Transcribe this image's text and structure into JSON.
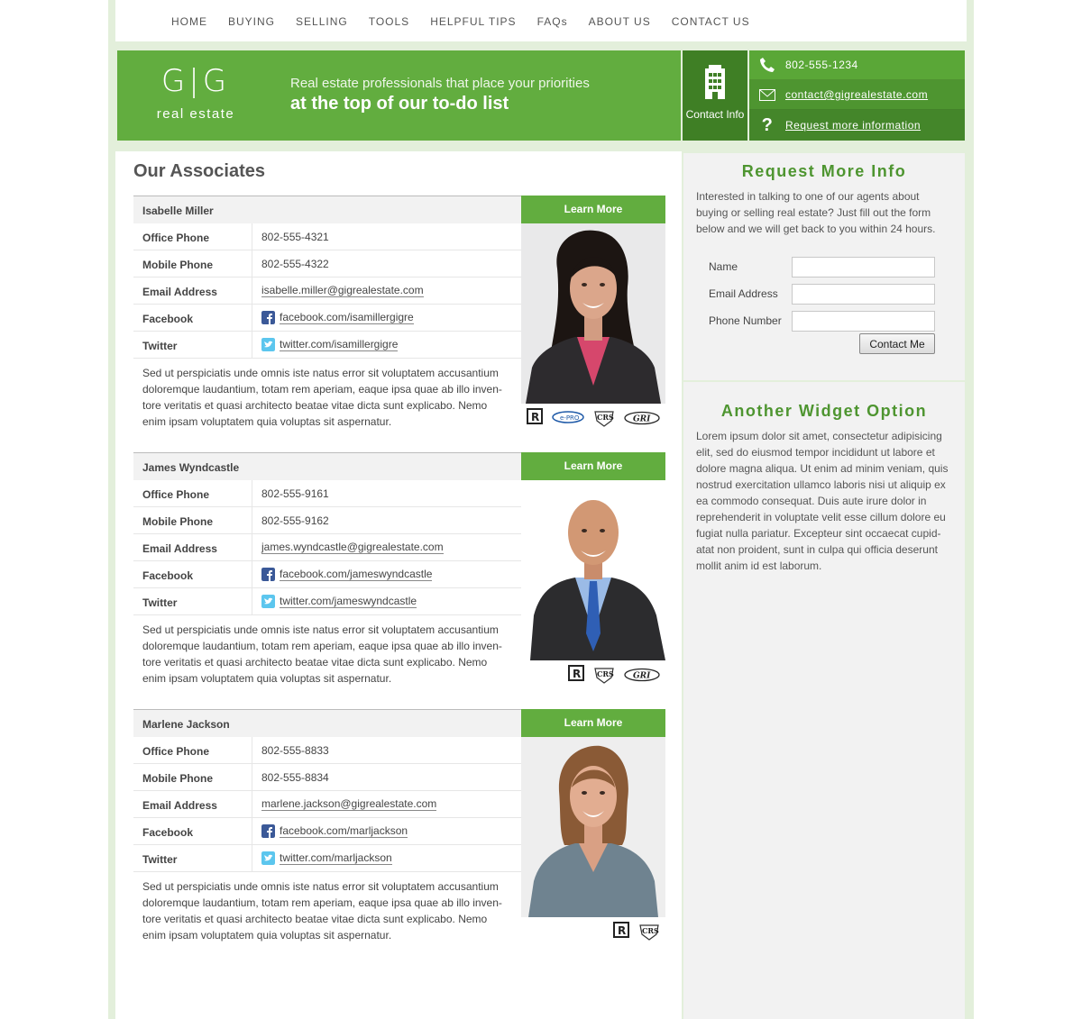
{
  "nav": {
    "items": [
      "HOME",
      "BUYING",
      "SELLING",
      "TOOLS",
      "HELPFUL TIPS",
      "FAQs",
      "ABOUT US",
      "CONTACT US"
    ]
  },
  "header": {
    "logo_mark": "G|G",
    "logo_text": "real estate",
    "tagline_line1": "Real estate professionals that place your priorities",
    "tagline_line2": "at the top of our to-do list",
    "contact_box_label": "Contact Info",
    "phone": "802-555-1234",
    "email": "contact@gigrealestate.com",
    "request": "Request more information"
  },
  "main": {
    "title": "Our Associates",
    "labels": {
      "office": "Office Phone",
      "mobile": "Mobile Phone",
      "email": "Email Address",
      "facebook": "Facebook",
      "twitter": "Twitter",
      "learn_more": "Learn More"
    },
    "associates": [
      {
        "name": "Isabelle Miller",
        "office": "802-555-4321",
        "mobile": "802-555-4322",
        "email": "isabelle.miller@gigrealestate.com",
        "facebook": "facebook.com/isamillergigre",
        "twitter": "twitter.com/isamillergigre",
        "description": "Sed ut perspiciatis unde omnis iste natus error sit voluptatem accusantium doloremque laudantium, totam rem aperiam, eaque ipsa quae ab illo inven-tore veritatis et quasi architecto beatae vitae dicta sunt explicabo. Nemo enim ipsam voluptatem quia voluptas sit aspernatur.",
        "badges": [
          "R",
          "e-PRO",
          "CRS",
          "GRI"
        ]
      },
      {
        "name": "James Wyndcastle",
        "office": "802-555-9161",
        "mobile": "802-555-9162",
        "email": "james.wyndcastle@gigrealestate.com",
        "facebook": "facebook.com/jameswyndcastle",
        "twitter": "twitter.com/jameswyndcastle",
        "description": "Sed ut perspiciatis unde omnis iste natus error sit voluptatem accusantium doloremque laudantium, totam rem aperiam, eaque ipsa quae ab illo inven-tore veritatis et quasi architecto beatae vitae dicta sunt explicabo. Nemo enim ipsam voluptatem quia voluptas sit aspernatur.",
        "badges": [
          "R",
          "CRS",
          "GRI"
        ]
      },
      {
        "name": "Marlene Jackson",
        "office": "802-555-8833",
        "mobile": "802-555-8834",
        "email": "marlene.jackson@gigrealestate.com",
        "facebook": "facebook.com/marljackson",
        "twitter": "twitter.com/marljackson",
        "description": "Sed ut perspiciatis unde omnis iste natus error sit voluptatem accusantium doloremque laudantium, totam rem aperiam, eaque ipsa quae ab illo inven-tore veritatis et quasi architecto beatae vitae dicta sunt explicabo. Nemo enim ipsam voluptatem quia voluptas sit aspernatur.",
        "badges": [
          "R",
          "CRS"
        ]
      }
    ]
  },
  "sidebar": {
    "request": {
      "title": "Request More Info",
      "text": "Interested in talking to one of our agents about buying or selling real estate? Just fill out the form below and we will get back to you within 24 hours.",
      "name_label": "Name",
      "email_label": "Email Address",
      "phone_label": "Phone Number",
      "button": "Contact Me"
    },
    "widget2": {
      "title": "Another Widget Option",
      "text": "Lorem ipsum dolor sit amet, consectetur adipisicing elit, sed do eiusmod tempor incididunt ut labore et dolore magna aliqua. Ut enim ad minim veniam, quis nostrud exercitation ullamco laboris nisi ut aliquip ex ea commodo consequat. Duis aute irure dolor in reprehenderit in voluptate velit esse cillum dolore eu fugiat nulla pariatur. Excepteur sint occaecat cupid-atat non proident, sunt in culpa qui officia deserunt mollit anim id est laborum."
    }
  },
  "colors": {
    "brand_green": "#62ad3f",
    "dark_green": "#3f7f25",
    "frame_green": "#e3efdb"
  }
}
